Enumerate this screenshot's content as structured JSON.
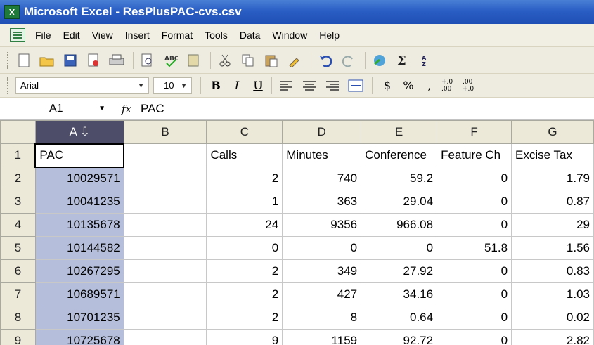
{
  "window": {
    "title": "Microsoft Excel - ResPlusPAC-cvs.csv",
    "app_icon": "X"
  },
  "menu": [
    "File",
    "Edit",
    "View",
    "Insert",
    "Format",
    "Tools",
    "Data",
    "Window",
    "Help"
  ],
  "toolbar_icons": [
    "new-icon",
    "open-icon",
    "save-icon",
    "permission-icon",
    "print-icon",
    "print-preview-icon",
    "spelling-icon",
    "research-icon",
    "cut-icon",
    "copy-icon",
    "paste-icon",
    "format-painter-icon",
    "undo-icon",
    "redo-icon",
    "hyperlink-icon",
    "autosum-icon",
    "sort-ascending-icon"
  ],
  "format": {
    "font": "Arial",
    "size": "10",
    "bold": "B",
    "italic": "I",
    "underline": "U",
    "currency": "$",
    "percent": "%",
    "comma": ",",
    "inc_decimal": "+.0 .00",
    "dec_decimal": ".00 +.0"
  },
  "formula_bar": {
    "cell_ref": "A1",
    "fx": "fx",
    "value": "PAC"
  },
  "columns": [
    "A",
    "B",
    "C",
    "D",
    "E",
    "F",
    "G"
  ],
  "rows": [
    {
      "n": "1",
      "cells": [
        "PAC",
        "",
        "Calls",
        "Minutes",
        "Conference",
        "Feature Ch",
        "Excise Tax"
      ]
    },
    {
      "n": "2",
      "cells": [
        "10029571",
        "",
        "2",
        "740",
        "59.2",
        "0",
        "1.79"
      ]
    },
    {
      "n": "3",
      "cells": [
        "10041235",
        "",
        "1",
        "363",
        "29.04",
        "0",
        "0.87"
      ]
    },
    {
      "n": "4",
      "cells": [
        "10135678",
        "",
        "24",
        "9356",
        "966.08",
        "0",
        "29"
      ]
    },
    {
      "n": "5",
      "cells": [
        "10144582",
        "",
        "0",
        "0",
        "0",
        "51.8",
        "1.56"
      ]
    },
    {
      "n": "6",
      "cells": [
        "10267295",
        "",
        "2",
        "349",
        "27.92",
        "0",
        "0.83"
      ]
    },
    {
      "n": "7",
      "cells": [
        "10689571",
        "",
        "2",
        "427",
        "34.16",
        "0",
        "1.03"
      ]
    },
    {
      "n": "8",
      "cells": [
        "10701235",
        "",
        "2",
        "8",
        "0.64",
        "0",
        "0.02"
      ]
    },
    {
      "n": "9",
      "cells": [
        "10725678",
        "",
        "9",
        "1159",
        "92.72",
        "0",
        "2.82"
      ]
    }
  ]
}
